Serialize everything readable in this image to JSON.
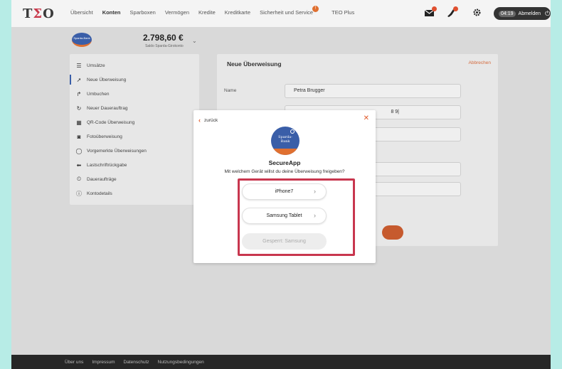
{
  "brand": {
    "logo_left": "T",
    "logo_accent": "Σ",
    "logo_right": "O"
  },
  "nav": {
    "items": [
      "Übersicht",
      "Konten",
      "Sparboxen",
      "Vermögen",
      "Kredite",
      "Kreditkarte",
      "Sicherheit und Service",
      "TEO Plus"
    ],
    "active": "Konten",
    "service_badge": "!"
  },
  "header": {
    "icons": [
      "mail-icon",
      "rocket-icon",
      "gear-icon"
    ],
    "session_time": "04:19",
    "logout_label": "Abmelden"
  },
  "account": {
    "bank_logo_text": "Sparda-Bank",
    "balance": "2.798,60 €",
    "balance_label": "Saldo Sparda-Girokonto"
  },
  "sidebar": {
    "items": [
      {
        "label": "Umsätze",
        "icon": "list-icon"
      },
      {
        "label": "Neue Überweisung",
        "icon": "transfer-arrow-icon"
      },
      {
        "label": "Umbuchen",
        "icon": "rebook-icon"
      },
      {
        "label": "Neuer Dauerauftrag",
        "icon": "repeat-icon"
      },
      {
        "label": "QR-Code Überweisung",
        "icon": "qr-code-icon"
      },
      {
        "label": "Fotoüberweisung",
        "icon": "camera-icon"
      },
      {
        "label": "Vorgemerkte Überweisungen",
        "icon": "clock-circle-icon"
      },
      {
        "label": "Lastschriftrückgabe",
        "icon": "return-arrow-icon"
      },
      {
        "label": "Daueraufträge",
        "icon": "timer-icon"
      },
      {
        "label": "Kontodetails",
        "icon": "info-icon"
      }
    ],
    "active_index": 1
  },
  "main": {
    "title": "Neue Überweisung",
    "cancel_label": "Abbrechen",
    "name_label": "Name",
    "name_value": "Petra Brugger",
    "iban_value_tail": "8 9|"
  },
  "modal": {
    "back_label": "zurück",
    "close_label": "✕",
    "logo_text_1": "Sparda-",
    "logo_text_2": "Bank",
    "title": "SecureApp",
    "subtitle": "Mit welchem Gerät willst du deine Überweisung freigeben?",
    "devices": [
      {
        "label": "iPhone7",
        "enabled": true
      },
      {
        "label": "Samsung Tablet",
        "enabled": true
      },
      {
        "label": "Gesperrt: Samsung",
        "enabled": false
      }
    ],
    "highlight_color": "#c8364e"
  },
  "footer": {
    "links": [
      "Über uns",
      "Impressum",
      "Datenschutz",
      "Nutzungsbedingungen"
    ]
  },
  "colors": {
    "accent": "#e05a2a",
    "bank_blue": "#3a5ea8",
    "highlight": "#c8364e"
  }
}
